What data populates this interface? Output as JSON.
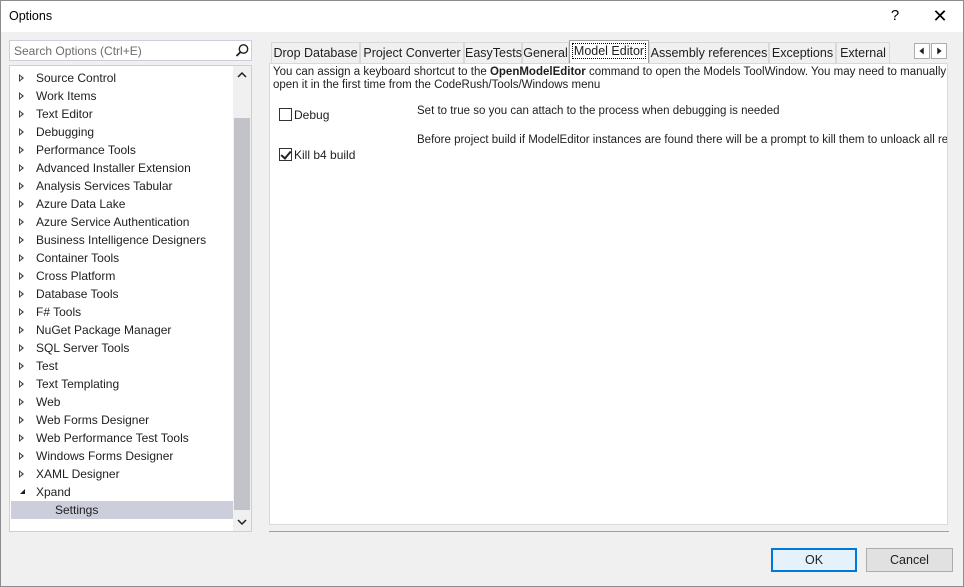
{
  "window": {
    "title": "Options",
    "help_glyph": "?",
    "close_glyph": "✕"
  },
  "search": {
    "placeholder": "Search Options (Ctrl+E)",
    "icon": "search-icon"
  },
  "tree": {
    "items": [
      {
        "label": "Source Control",
        "state": "collapsed"
      },
      {
        "label": "Work Items",
        "state": "collapsed"
      },
      {
        "label": "Text Editor",
        "state": "collapsed"
      },
      {
        "label": "Debugging",
        "state": "collapsed"
      },
      {
        "label": "Performance Tools",
        "state": "collapsed"
      },
      {
        "label": "Advanced Installer Extension",
        "state": "collapsed"
      },
      {
        "label": "Analysis Services Tabular",
        "state": "collapsed"
      },
      {
        "label": "Azure Data Lake",
        "state": "collapsed"
      },
      {
        "label": "Azure Service Authentication",
        "state": "collapsed"
      },
      {
        "label": "Business Intelligence Designers",
        "state": "collapsed"
      },
      {
        "label": "Container Tools",
        "state": "collapsed"
      },
      {
        "label": "Cross Platform",
        "state": "collapsed"
      },
      {
        "label": "Database Tools",
        "state": "collapsed"
      },
      {
        "label": "F# Tools",
        "state": "collapsed"
      },
      {
        "label": "NuGet Package Manager",
        "state": "collapsed"
      },
      {
        "label": "SQL Server Tools",
        "state": "collapsed"
      },
      {
        "label": "Test",
        "state": "collapsed"
      },
      {
        "label": "Text Templating",
        "state": "collapsed"
      },
      {
        "label": "Web",
        "state": "collapsed"
      },
      {
        "label": "Web Forms Designer",
        "state": "collapsed"
      },
      {
        "label": "Web Performance Test Tools",
        "state": "collapsed"
      },
      {
        "label": "Windows Forms Designer",
        "state": "collapsed"
      },
      {
        "label": "XAML Designer",
        "state": "collapsed"
      },
      {
        "label": "Xpand",
        "state": "expanded"
      },
      {
        "label": "Settings",
        "state": "child-selected"
      }
    ]
  },
  "tabs": [
    {
      "label": "Drop Database",
      "active": false
    },
    {
      "label": "Project Converter",
      "active": false
    },
    {
      "label": "EasyTests",
      "active": false
    },
    {
      "label": "General",
      "active": false
    },
    {
      "label": "Model Editor",
      "active": true
    },
    {
      "label": "Assembly references",
      "active": false
    },
    {
      "label": "Exceptions",
      "active": false
    },
    {
      "label": "External",
      "active": false
    }
  ],
  "panel": {
    "description_prefix": "You can assign a keyboard shortcut to the ",
    "description_command": "OpenModelEditor",
    "description_suffix": " command to open the Models ToolWindow. You may need to manually open it in the first time from the CodeRush/Tools/Windows menu",
    "options": [
      {
        "label": "Debug",
        "checked": false,
        "description": "Set to true so you can attach to the process when debugging is needed"
      },
      {
        "label": "Kill b4 build",
        "checked": true,
        "description": "Before project build if ModelEditor instances are found there will be a prompt to kill them to unloack all related a"
      }
    ]
  },
  "buttons": {
    "ok": "OK",
    "cancel": "Cancel"
  },
  "colors": {
    "selection": "#cccedb",
    "accent": "#0078d7",
    "scroll_thumb": "#c2c3c9"
  }
}
